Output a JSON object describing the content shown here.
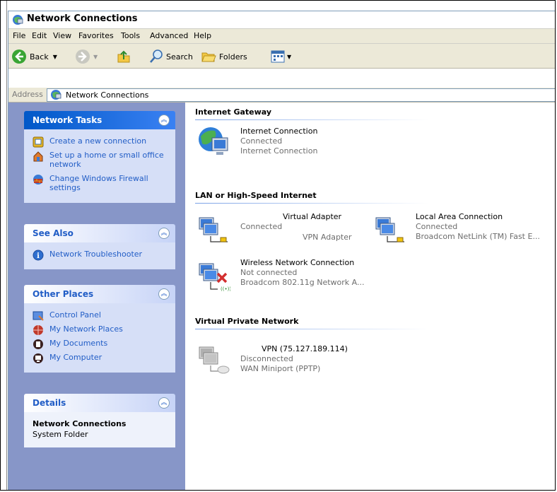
{
  "window": {
    "title": "Network Connections"
  },
  "menu": [
    "File",
    "Edit",
    "View",
    "Favorites",
    "Tools",
    "Advanced",
    "Help"
  ],
  "toolbar": {
    "back": "Back",
    "search": "Search",
    "folders": "Folders"
  },
  "address": {
    "label": "Address",
    "value": "Network Connections"
  },
  "sidebar": {
    "network_tasks": {
      "title": "Network Tasks",
      "items": [
        "Create a new connection",
        "Set up a home or small office network",
        "Change Windows Firewall settings"
      ]
    },
    "see_also": {
      "title": "See Also",
      "items": [
        "Network Troubleshooter"
      ]
    },
    "other_places": {
      "title": "Other Places",
      "items": [
        "Control Panel",
        "My Network Places",
        "My Documents",
        "My Computer"
      ]
    },
    "details": {
      "title": "Details",
      "name": "Network Connections",
      "type": "System Folder"
    }
  },
  "groups": {
    "internet_gateway": "Internet Gateway",
    "lan": "LAN or High-Speed Internet",
    "vpn": "Virtual Private Network"
  },
  "connections": {
    "internet": {
      "name": "Internet Connection",
      "status": "Connected",
      "device": "Internet Connection"
    },
    "virtual": {
      "name": "Virtual Adapter",
      "status": "Connected",
      "device": "VPN Adapter"
    },
    "local": {
      "name": "Local Area Connection",
      "status": "Connected",
      "device": "Broadcom NetLink (TM) Fast E..."
    },
    "wireless": {
      "name": "Wireless Network Connection",
      "status": "Not connected",
      "device": "Broadcom 802.11g Network A..."
    },
    "vpn": {
      "name": "VPN (75.127.189.114)",
      "status": "Disconnected",
      "device": "WAN Miniport (PPTP)"
    }
  },
  "colors": {
    "link": "#215dc6",
    "sidebar_bg": "#8796c8",
    "panel_bg": "#d6dff7",
    "status_gray": "#6d6d6d"
  }
}
